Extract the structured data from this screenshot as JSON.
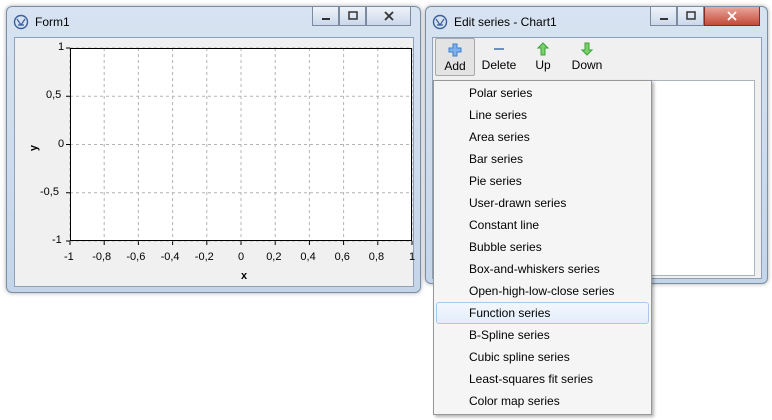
{
  "form1": {
    "title": "Form1",
    "chart": {
      "y_ticks": [
        "1",
        "0,5",
        "0",
        "-0,5",
        "-1"
      ],
      "x_ticks": [
        "-1",
        "-0,8",
        "-0,6",
        "-0,4",
        "-0,2",
        "0",
        "0,2",
        "0,4",
        "0,6",
        "0,8",
        "1"
      ],
      "xlabel": "x",
      "ylabel": "y"
    }
  },
  "editor": {
    "title": "Edit series - Chart1",
    "toolbar": {
      "add_label": "Add",
      "delete_label": "Delete",
      "up_label": "Up",
      "down_label": "Down"
    }
  },
  "menu": {
    "items": [
      "Polar series",
      "Line series",
      "Area series",
      "Bar series",
      "Pie series",
      "User-drawn series",
      "Constant line",
      "Bubble series",
      "Box-and-whiskers series",
      "Open-high-low-close series",
      "Function series",
      "B-Spline series",
      "Cubic spline series",
      "Least-squares fit series",
      "Color map series"
    ],
    "highlighted_item": "Function series"
  },
  "colors": {
    "titlebar": "#c9d9ee",
    "add_icon": "#3c7fd0",
    "up_down_icon": "#3aa33a",
    "highlight": "#e2edfa"
  }
}
